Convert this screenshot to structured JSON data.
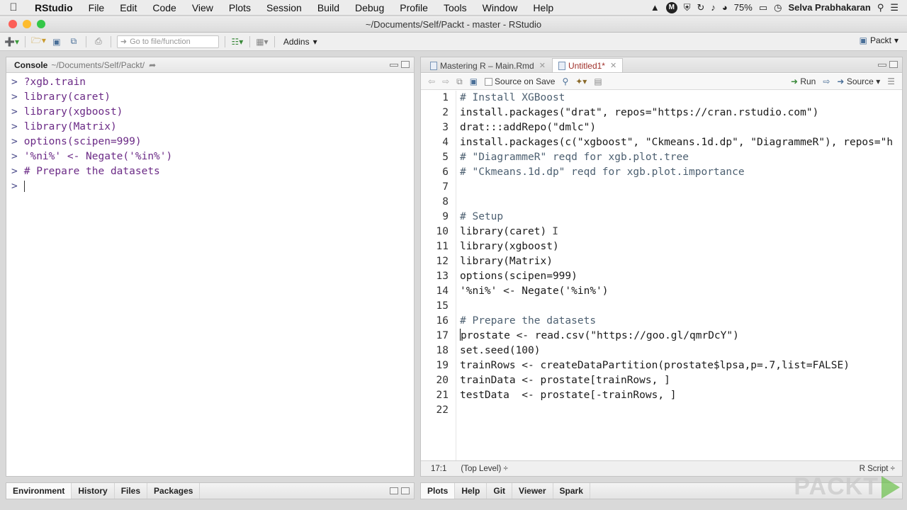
{
  "menubar": {
    "app": "RStudio",
    "items": [
      "File",
      "Edit",
      "Code",
      "View",
      "Plots",
      "Session",
      "Build",
      "Debug",
      "Profile",
      "Tools",
      "Window",
      "Help"
    ],
    "battery": "75%",
    "user": "Selva Prabhakaran"
  },
  "window": {
    "title": "~/Documents/Self/Packt - master - RStudio"
  },
  "toolbar": {
    "goto_placeholder": "Go to file/function",
    "addins_label": "Addins",
    "project_label": "Packt"
  },
  "console": {
    "title": "Console",
    "path": "~/Documents/Self/Packt/",
    "lines": [
      "?xgb.train",
      "library(caret)",
      "library(xgboost)",
      "library(Matrix)",
      "options(scipen=999)",
      "'%ni%' <- Negate('%in%')",
      "# Prepare the datasets"
    ],
    "prompt": ">"
  },
  "editor": {
    "tabs": [
      {
        "label": "Mastering R – Main.Rmd",
        "active": false
      },
      {
        "label": "Untitled1*",
        "active": true
      }
    ],
    "source_on_save_label": "Source on Save",
    "run_label": "Run",
    "source_label": "Source",
    "line_numbers": [
      "1",
      "2",
      "3",
      "4",
      "5",
      "6",
      "7",
      "8",
      "9",
      "10",
      "11",
      "12",
      "13",
      "14",
      "15",
      "16",
      "17",
      "18",
      "19",
      "20",
      "21",
      "22"
    ],
    "code_lines": [
      "# Install XGBoost",
      "install.packages(\"drat\", repos=\"https://cran.rstudio.com\")",
      "drat:::addRepo(\"dmlc\")",
      "install.packages(c(\"xgboost\", \"Ckmeans.1d.dp\", \"DiagrammeR\"), repos=\"h",
      "# \"DiagrammeR\" reqd for xgb.plot.tree",
      "# \"Ckmeans.1d.dp\" reqd for xgb.plot.importance",
      "",
      "",
      "# Setup",
      "library(caret)",
      "library(xgboost)",
      "library(Matrix)",
      "options(scipen=999)",
      "'%ni%' <- Negate('%in%')",
      "",
      "# Prepare the datasets",
      "prostate <- read.csv(\"https://goo.gl/qmrDcY\")",
      "set.seed(100)",
      "trainRows <- createDataPartition(prostate$lpsa,p=.7,list=FALSE)",
      "trainData <- prostate[trainRows, ]",
      "testData  <- prostate[-trainRows, ]",
      ""
    ],
    "status_position": "17:1",
    "status_scope": "(Top Level) ÷",
    "status_type": "R Script ÷"
  },
  "bottom_left_tabs": [
    "Environment",
    "History",
    "Files",
    "Packages"
  ],
  "bottom_right_tabs": [
    "Plots",
    "Help",
    "Git",
    "Viewer",
    "Spark"
  ],
  "watermark": "PACKT",
  "colors": {
    "close": "#fc5f57",
    "minimize": "#fdbc2e",
    "zoom": "#33c748",
    "console_text": "#6b2a86",
    "active_tab": "#a0302a"
  }
}
